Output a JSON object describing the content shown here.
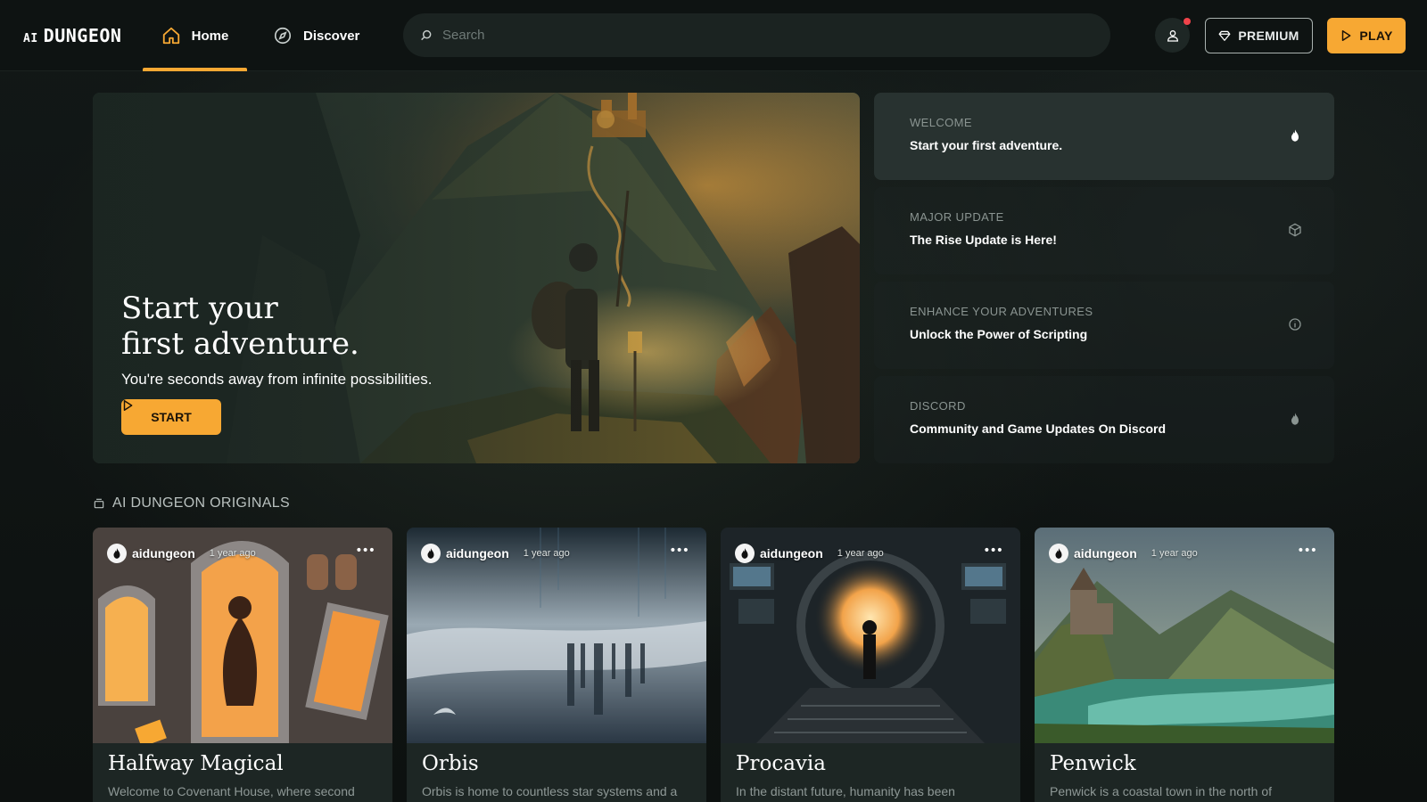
{
  "header": {
    "logo_ai": "AI",
    "logo_name": "DUNGEON",
    "nav": [
      {
        "label": "Home",
        "icon": "home-icon",
        "active": true
      },
      {
        "label": "Discover",
        "icon": "compass-icon",
        "active": false
      }
    ],
    "search_placeholder": "Search",
    "premium_label": "PREMIUM",
    "play_label": "PLAY",
    "accent_color": "#f7a833",
    "notification_color": "#f0434a"
  },
  "hero": {
    "title_line1": "Start your",
    "title_line2": "first adventure.",
    "subtitle": "You're seconds away from infinite possibilities.",
    "start_label": "START"
  },
  "news": [
    {
      "label": "WELCOME",
      "title": "Start your first adventure.",
      "icon": "flame-icon",
      "active": true
    },
    {
      "label": "MAJOR UPDATE",
      "title": "The Rise Update is Here!",
      "icon": "cube-icon",
      "active": false
    },
    {
      "label": "ENHANCE YOUR ADVENTURES",
      "title": "Unlock the Power of Scripting",
      "icon": "info-icon",
      "active": false
    },
    {
      "label": "DISCORD",
      "title": "Community and Game Updates On Discord",
      "icon": "flame-icon",
      "active": false
    }
  ],
  "originals": {
    "heading": "AI DUNGEON ORIGINALS",
    "cards": [
      {
        "author": "aidungeon",
        "time": "1 year ago",
        "title": "Halfway Magical",
        "description": "Welcome to Covenant House, where second"
      },
      {
        "author": "aidungeon",
        "time": "1 year ago",
        "title": "Orbis",
        "description": "Orbis is home to countless star systems and a"
      },
      {
        "author": "aidungeon",
        "time": "1 year ago",
        "title": "Procavia",
        "description": "In the distant future, humanity has been"
      },
      {
        "author": "aidungeon",
        "time": "1 year ago",
        "title": "Penwick",
        "description": "Penwick is a coastal town in the north of"
      }
    ]
  }
}
